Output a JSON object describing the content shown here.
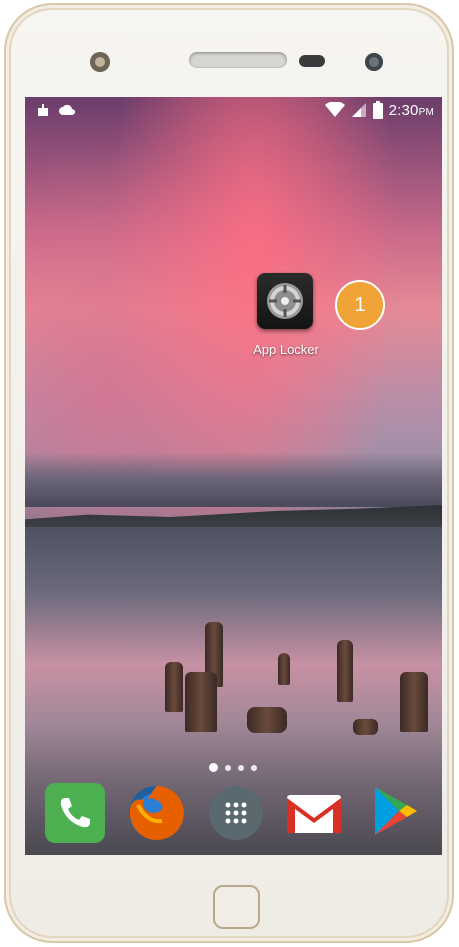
{
  "status_bar": {
    "time": "2:30",
    "ampm": "PM",
    "icons": [
      "android-debug-icon",
      "cloud-icon",
      "wifi-icon",
      "signal-icon",
      "battery-icon"
    ]
  },
  "home_screen": {
    "app": {
      "label": "App Locker",
      "icon": "lock-dial-icon"
    },
    "callout_badge": "1",
    "page_indicator": {
      "pages": 4,
      "current": 1
    }
  },
  "dock": [
    {
      "name": "Phone",
      "icon": "phone-icon",
      "color": "#4caf50"
    },
    {
      "name": "Firefox",
      "icon": "firefox-icon",
      "color": "#e66000"
    },
    {
      "name": "Apps",
      "icon": "app-drawer-icon",
      "color": "#5a6870"
    },
    {
      "name": "Gmail",
      "icon": "gmail-icon",
      "color": "#d93025"
    },
    {
      "name": "Play Store",
      "icon": "play-store-icon",
      "color": "#34a853"
    }
  ],
  "colors": {
    "badge": "#f0a336",
    "phone_frame": "#f7f5f1",
    "phone_trim": "#d8c7a8"
  }
}
